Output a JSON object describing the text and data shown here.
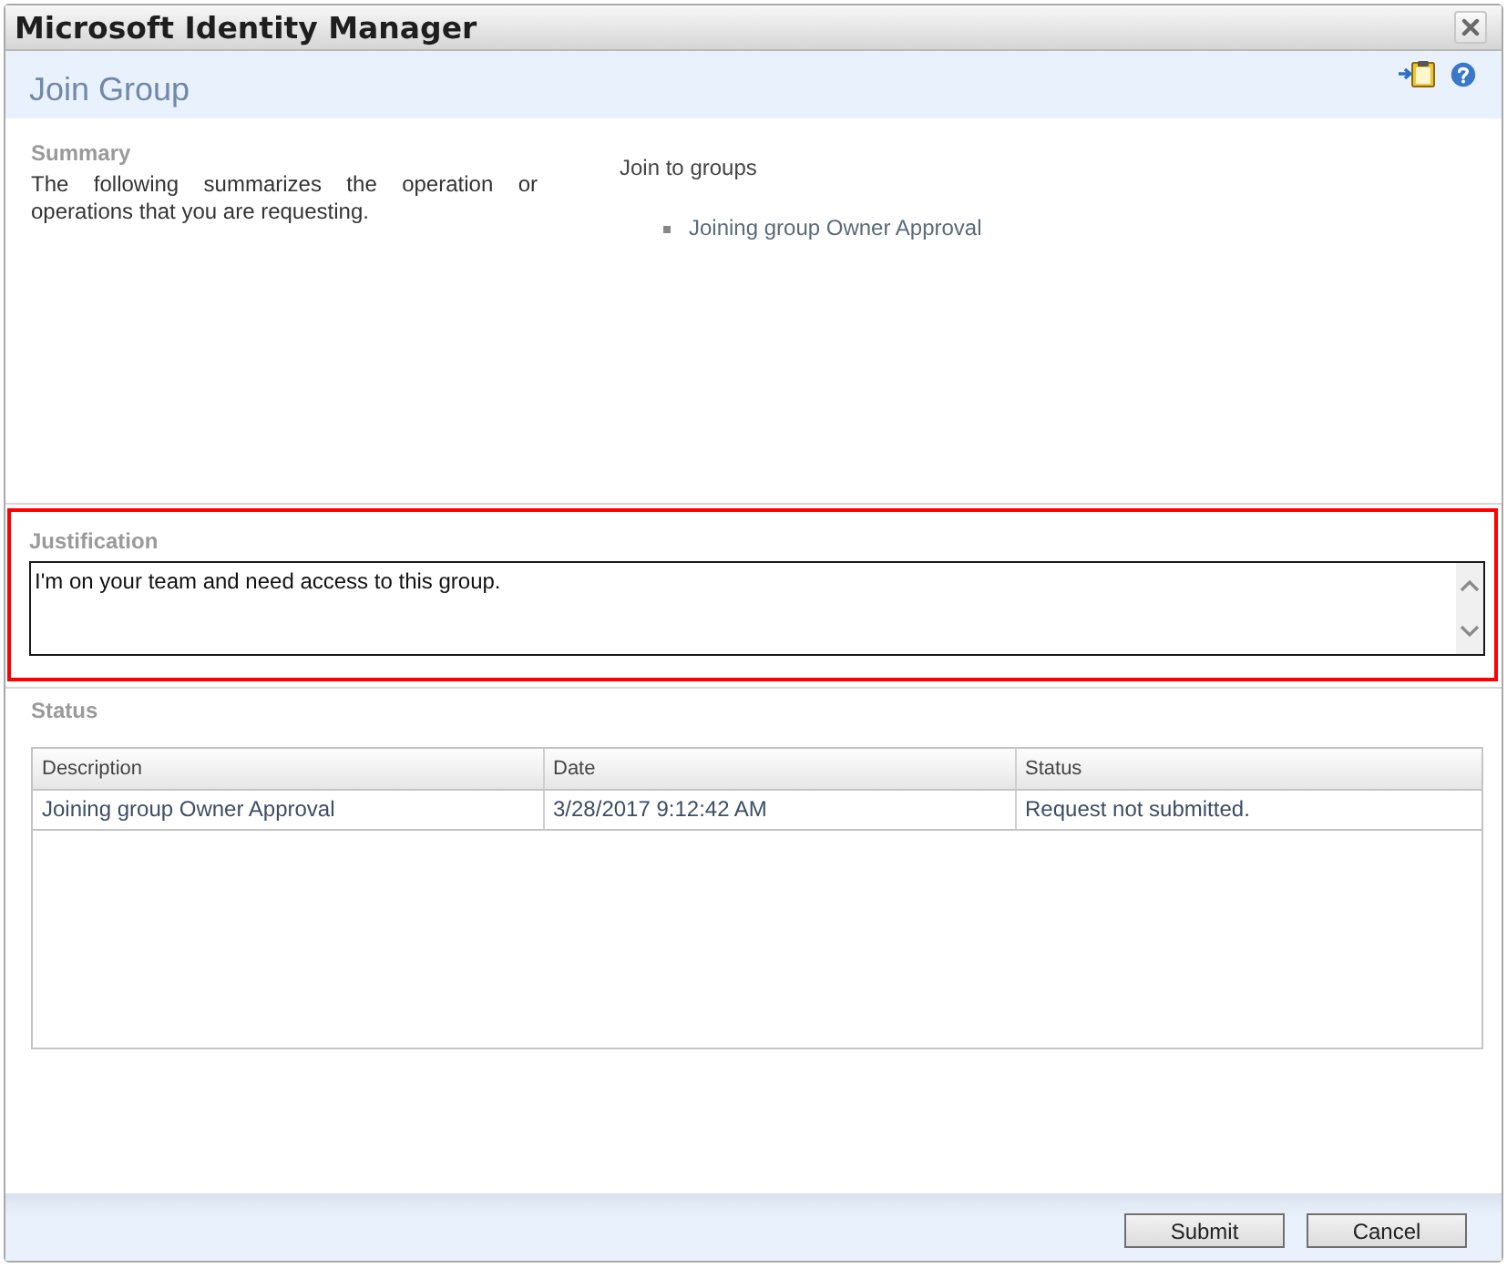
{
  "window": {
    "title": "Microsoft Identity Manager"
  },
  "header": {
    "title": "Join Group"
  },
  "summary": {
    "heading": "Summary",
    "description": "The following summarizes the operation or operations that you are requesting.",
    "operation": "Join to groups",
    "items": [
      "Joining group Owner Approval"
    ]
  },
  "justification": {
    "label": "Justification",
    "value": "I'm on your team and need access to this group.",
    "highlighted": true
  },
  "status": {
    "heading": "Status",
    "table": {
      "columns": [
        "Description",
        "Date",
        "Status"
      ],
      "rows": [
        [
          "Joining group Owner Approval",
          "3/28/2017 9:12:42 AM",
          "Request not submitted."
        ]
      ]
    }
  },
  "buttons": [
    "Submit",
    "Cancel"
  ]
}
